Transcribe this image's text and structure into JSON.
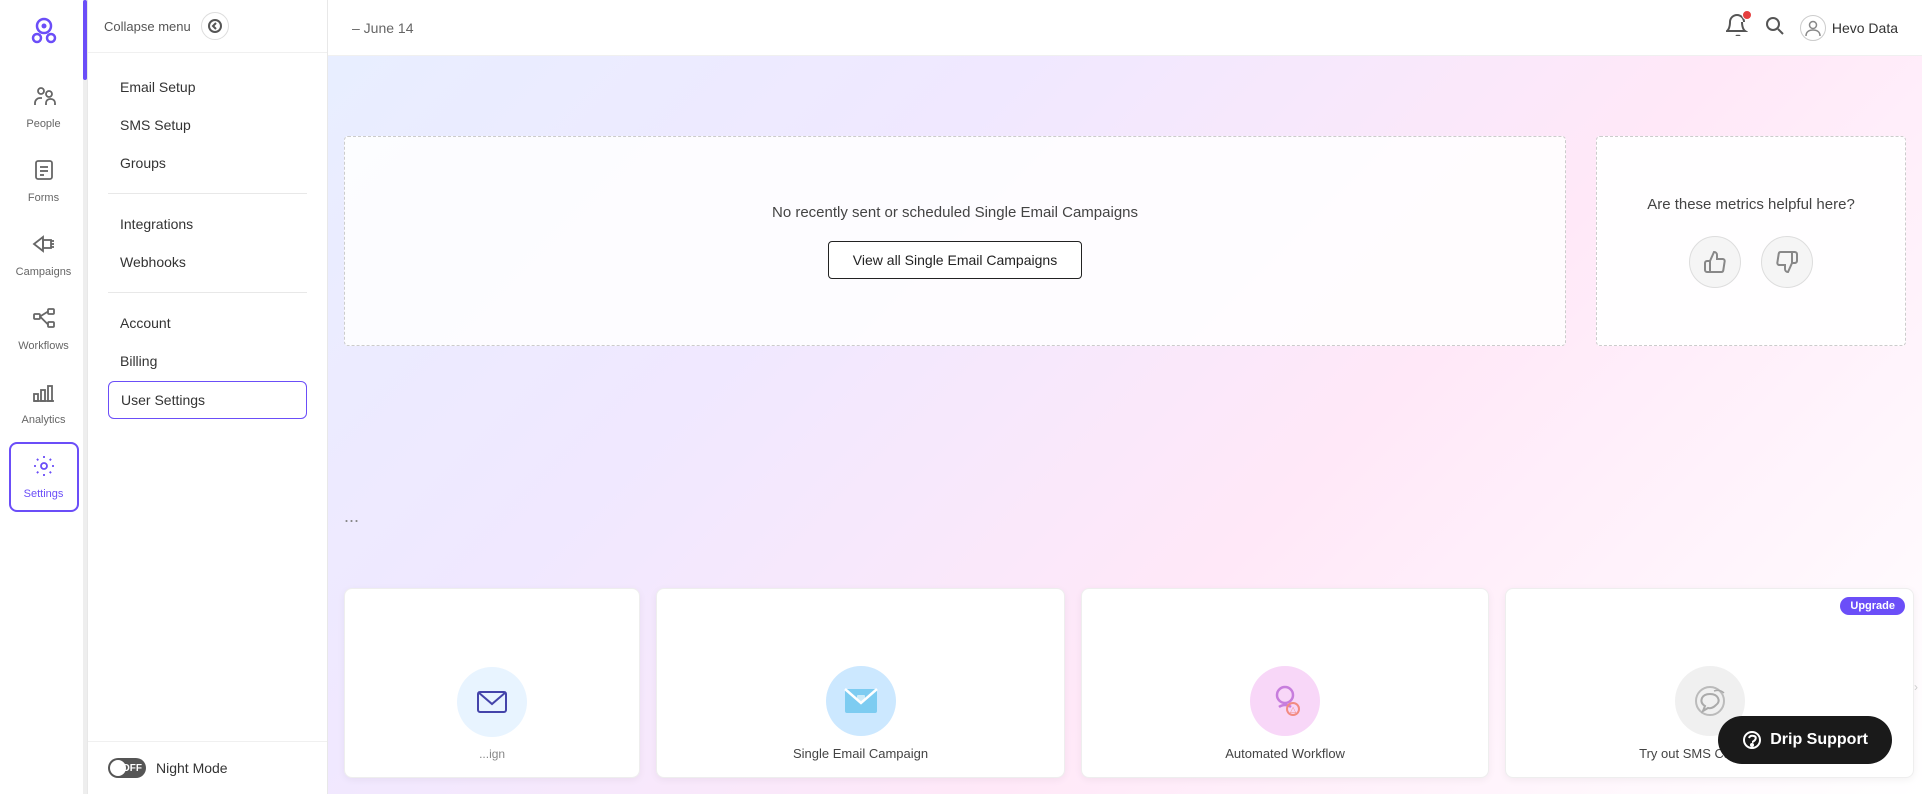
{
  "sidebar_narrow": {
    "nav_items": [
      {
        "id": "people",
        "label": "People",
        "icon": "👥",
        "active": false
      },
      {
        "id": "forms",
        "label": "Forms",
        "icon": "📋",
        "active": false
      },
      {
        "id": "campaigns",
        "label": "Campaigns",
        "icon": "📣",
        "active": false
      },
      {
        "id": "workflows",
        "label": "Workflows",
        "icon": "⚙️",
        "active": false
      },
      {
        "id": "analytics",
        "label": "Analytics",
        "icon": "📊",
        "active": false
      },
      {
        "id": "settings",
        "label": "Settings",
        "icon": "⚙️",
        "active": true
      }
    ]
  },
  "sidebar_expanded": {
    "collapse_label": "Collapse menu",
    "menu_items": [
      {
        "id": "email-setup",
        "label": "Email Setup",
        "active": false
      },
      {
        "id": "sms-setup",
        "label": "SMS Setup",
        "active": false
      },
      {
        "id": "groups",
        "label": "Groups",
        "active": false
      },
      {
        "id": "integrations",
        "label": "Integrations",
        "active": false
      },
      {
        "id": "webhooks",
        "label": "Webhooks",
        "active": false
      },
      {
        "id": "account",
        "label": "Account",
        "active": false
      },
      {
        "id": "billing",
        "label": "Billing",
        "active": false
      },
      {
        "id": "user-settings",
        "label": "User Settings",
        "active": true
      }
    ],
    "night_mode": {
      "label": "Night Mode",
      "toggle_state": "OFF"
    }
  },
  "topbar": {
    "date_range": "– June 14",
    "user_name": "Hevo Data",
    "notification_icon": "🔔",
    "search_icon": "🔍",
    "user_icon": "👤"
  },
  "campaign_section": {
    "empty_text": "No recently sent or scheduled Single Email Campaigns",
    "view_all_button": "View all Single Email Campaigns"
  },
  "metrics_card": {
    "question": "Are these metrics helpful here?",
    "thumbs_up": "👍",
    "thumbs_down": "👎"
  },
  "campaign_cards": [
    {
      "id": "single-email",
      "label": "Single Email Campaign",
      "icon_bg": "#cce8ff",
      "icon": "✉️"
    },
    {
      "id": "automated-workflow",
      "label": "Automated Workflow",
      "icon_bg": "#f8d7f8",
      "icon": "🔄"
    },
    {
      "id": "sms-campaigns",
      "label": "Try out SMS Campaigns",
      "icon_bg": "#f0f0f0",
      "icon": "💬",
      "has_upgrade": true
    }
  ],
  "drip_support": {
    "label": "Drip Support"
  },
  "ellipsis": "..."
}
